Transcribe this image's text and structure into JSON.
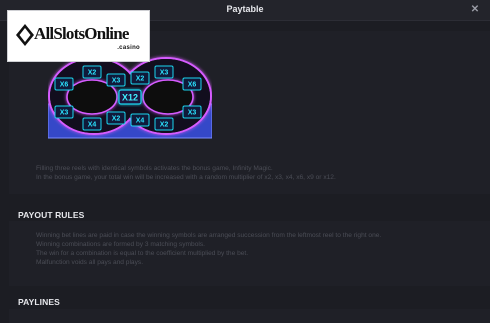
{
  "header": {
    "title": "Paytable",
    "close_icon": "close-icon"
  },
  "logo": {
    "brand": "AllSlotsOnline",
    "tld": ".casino",
    "icon": "diamond-suit-icon"
  },
  "bonus_board": {
    "center_label": "X12",
    "labels": [
      "X6",
      "X2",
      "X3",
      "X2",
      "X3",
      "X6",
      "X3",
      "X4",
      "X2",
      "X4",
      "X2",
      "X3"
    ],
    "colors": {
      "glow": "#d65cff",
      "cells": "#1ad6f0",
      "base": "#3548c8"
    }
  },
  "bonus_description": [
    "Filling three reels with identical symbols activates the bonus game, Infinity Magic.",
    "In the bonus game, your total win will be increased with a random multiplier of x2, x3, x4, x6, x9 or x12."
  ],
  "payout_rules": {
    "title": "PAYOUT RULES",
    "lines": [
      "Winning bet lines are paid in case the winning symbols are arranged succession from the leftmost reel to the right one.",
      "Winning combinations are formed by 3 matching symbols.",
      "The win for a combination is equal to the coefficient multiplied by the bet.",
      "Malfunction voids all pays and plays."
    ]
  },
  "paylines": {
    "title": "PAYLINES"
  }
}
